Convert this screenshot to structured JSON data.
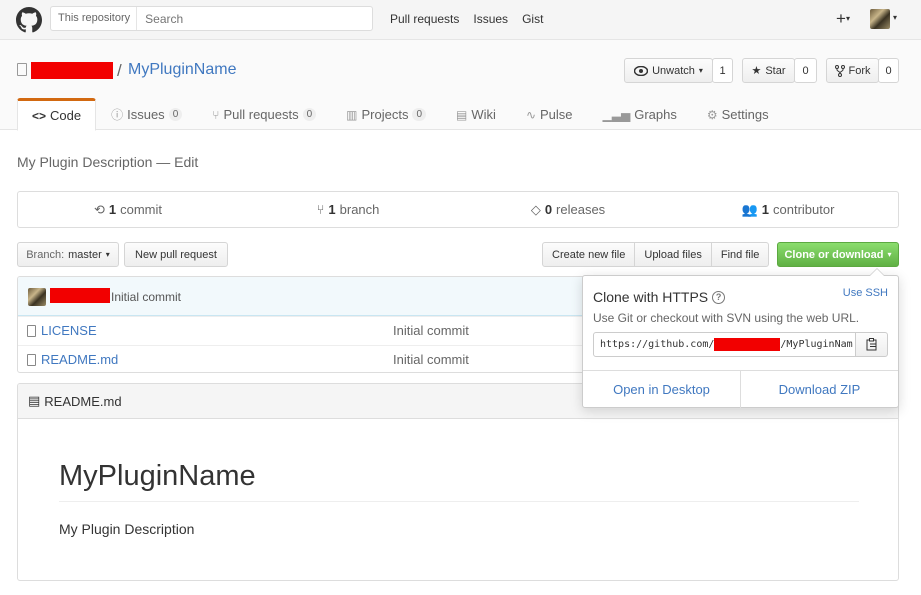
{
  "header": {
    "search_scope": "This repository",
    "search_placeholder": "Search",
    "nav": [
      "Pull requests",
      "Issues",
      "Gist"
    ],
    "new_icon": "plus-icon"
  },
  "repo": {
    "name": "MyPluginName",
    "separator": "/",
    "unwatch_label": "Unwatch",
    "watch_count": "1",
    "star_label": "Star",
    "star_count": "0",
    "fork_label": "Fork",
    "fork_count": "0"
  },
  "tabs": [
    {
      "label": "Code",
      "icon": "code-icon"
    },
    {
      "label": "Issues",
      "count": "0",
      "icon": "issue-icon"
    },
    {
      "label": "Pull requests",
      "count": "0",
      "icon": "pull-request-icon"
    },
    {
      "label": "Projects",
      "count": "0",
      "icon": "project-icon"
    },
    {
      "label": "Wiki",
      "icon": "book-icon"
    },
    {
      "label": "Pulse",
      "icon": "pulse-icon"
    },
    {
      "label": "Graphs",
      "icon": "graph-icon"
    },
    {
      "label": "Settings",
      "icon": "gear-icon"
    }
  ],
  "description": {
    "text": "My Plugin Description",
    "dash": "—",
    "edit": "Edit"
  },
  "numbers": [
    {
      "value": "1",
      "label": "commit"
    },
    {
      "value": "1",
      "label": "branch"
    },
    {
      "value": "0",
      "label": "releases"
    },
    {
      "value": "1",
      "label": "contributor"
    }
  ],
  "toolbar": {
    "branch_prefix": "Branch:",
    "branch_name": "master",
    "new_pr": "New pull request",
    "create_file": "Create new file",
    "upload_files": "Upload files",
    "find_file": "Find file",
    "clone": "Clone or download"
  },
  "commit": {
    "message": "Initial commit"
  },
  "files": [
    {
      "name": "LICENSE",
      "message": "Initial commit"
    },
    {
      "name": "README.md",
      "message": "Initial commit"
    }
  ],
  "readme": {
    "filename": "README.md",
    "heading": "MyPluginName",
    "body": "My Plugin Description"
  },
  "clone_popover": {
    "title": "Clone with HTTPS",
    "use_ssh": "Use SSH",
    "subtitle": "Use Git or checkout with SVN using the web URL.",
    "url_prefix": "https://github.com/",
    "url_suffix": "/MyPluginNam",
    "open_desktop": "Open in Desktop",
    "download_zip": "Download ZIP"
  },
  "colors": {
    "accent_link": "#4078c0",
    "tab_selected": "#d26911",
    "clone_green": "#60b044",
    "redaction": "#f20000"
  }
}
